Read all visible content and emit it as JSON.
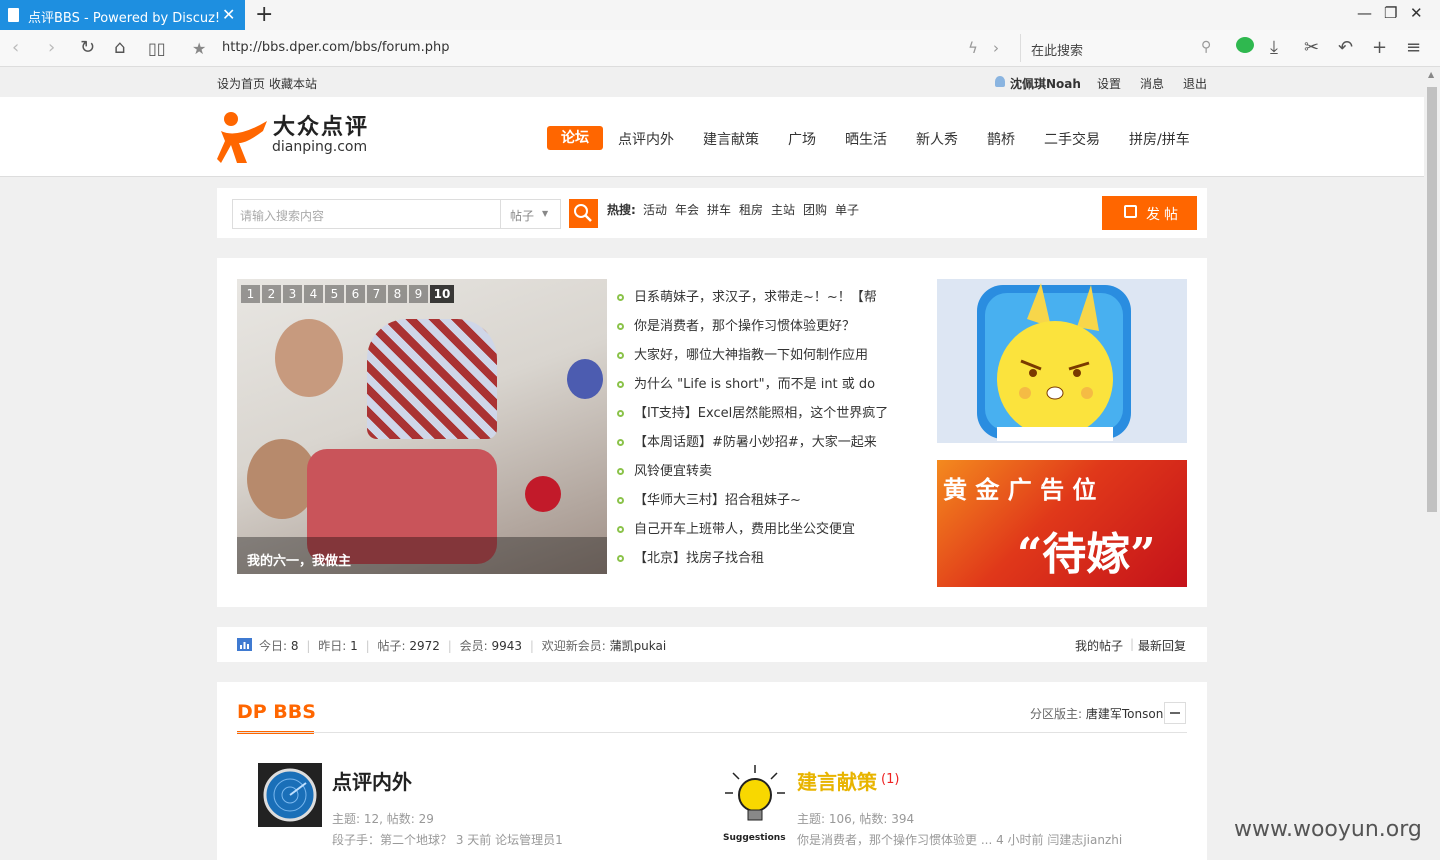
{
  "browser": {
    "tab_title": "点评BBS - Powered by Discuz!",
    "url": "http://bbs.dper.com/bbs/forum.php",
    "search_placeholder": "在此搜索"
  },
  "topbar": {
    "set_home": "设为首页",
    "bookmark": "收藏本站",
    "username": "沈佩琪Noah",
    "settings": "设置",
    "messages": "消息",
    "logout": "退出"
  },
  "logo": {
    "cn": "大众点评",
    "en": "dianping.com"
  },
  "nav": [
    "论坛",
    "点评内外",
    "建言献策",
    "广场",
    "晒生活",
    "新人秀",
    "鹊桥",
    "二手交易",
    "拼房/拼车"
  ],
  "search": {
    "placeholder": "请输入搜索内容",
    "type": "帖子",
    "hot_label": "热搜:",
    "hot": [
      "活动",
      "年会",
      "拼车",
      "租房",
      "主站",
      "团购",
      "单子"
    ],
    "post_button": "发帖"
  },
  "slideshow": {
    "pages": [
      "1",
      "2",
      "3",
      "4",
      "5",
      "6",
      "7",
      "8",
      "9",
      "10"
    ],
    "active_page": "10",
    "caption": "我的六一，我做主"
  },
  "threads": [
    "日系萌妹子，求汉子，求带走~！~！【帮",
    "你是消费者，那个操作习惯体验更好？",
    "大家好，哪位大神指教一下如何制作应用",
    "为什么 \"Life is short\"，而不是 int 或 do",
    "【IT支持】Excel居然能照相，这个世界疯了",
    "【本周话题】#防暑小妙招#，大家一起来",
    "风铃便宜转卖",
    "【华师大三村】招合租妹子~",
    "自己开车上班带人，费用比坐公交便宜",
    "【北京】找房子找合租"
  ],
  "ads": {
    "gold_title": "黄 金 广 告 位",
    "gold_sub": "“待嫁”"
  },
  "stats": {
    "today_label": "今日:",
    "today": "8",
    "yesterday_label": "昨日:",
    "yesterday": "1",
    "posts_label": "帖子:",
    "posts": "2972",
    "members_label": "会员:",
    "members": "9943",
    "welcome_label": "欢迎新会员:",
    "new_member": "蒲凯pukai",
    "my_posts": "我的帖子",
    "latest": "最新回复"
  },
  "section": {
    "title": "DP BBS",
    "moderator_label": "分区版主:",
    "moderator": "唐建军Tonson",
    "forums": [
      {
        "name": "点评内外",
        "count": "",
        "stats": "主题: 12, 帖数: 29",
        "last": "段子手：第二个地球？ 3 天前 论坛管理员1"
      },
      {
        "name": "建言献策",
        "count": "(1)",
        "icon_label": "Suggestions",
        "stats": "主题: 106, 帖数: 394",
        "last": "你是消费者，那个操作习惯体验更 ... 4 小时前 闫建志jianzhi"
      }
    ]
  },
  "watermark": "www.wooyun.org",
  "colors": {
    "accent": "#ff6600",
    "tab": "#1e8fe0",
    "gold": "#e8b400"
  }
}
